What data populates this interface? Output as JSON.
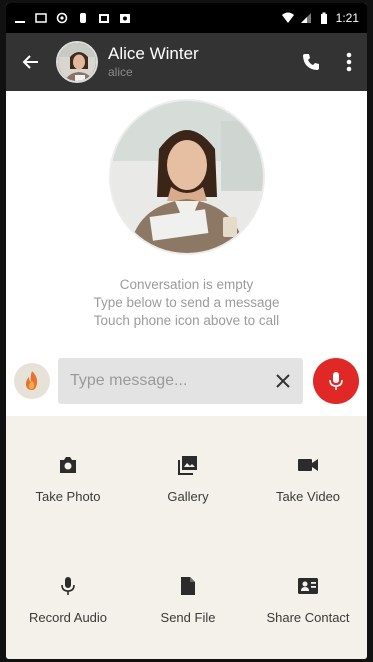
{
  "status_bar": {
    "time": "1:21"
  },
  "header": {
    "contact_name": "Alice Winter",
    "contact_handle": "alice"
  },
  "conversation": {
    "empty_lines": [
      "Conversation is empty",
      "Type below to send a message",
      "Touch phone icon above to call"
    ]
  },
  "composer": {
    "placeholder": "Type message..."
  },
  "attachments": [
    {
      "label": "Take Photo",
      "icon": "camera-icon"
    },
    {
      "label": "Gallery",
      "icon": "gallery-icon"
    },
    {
      "label": "Take Video",
      "icon": "videocam-icon"
    },
    {
      "label": "Record Audio",
      "icon": "mic-icon"
    },
    {
      "label": "Send File",
      "icon": "file-icon"
    },
    {
      "label": "Share Contact",
      "icon": "contact-card-icon"
    }
  ],
  "colors": {
    "app_bar": "#333333",
    "mic_button": "#e02827",
    "panel_background": "#f4f1ea"
  }
}
